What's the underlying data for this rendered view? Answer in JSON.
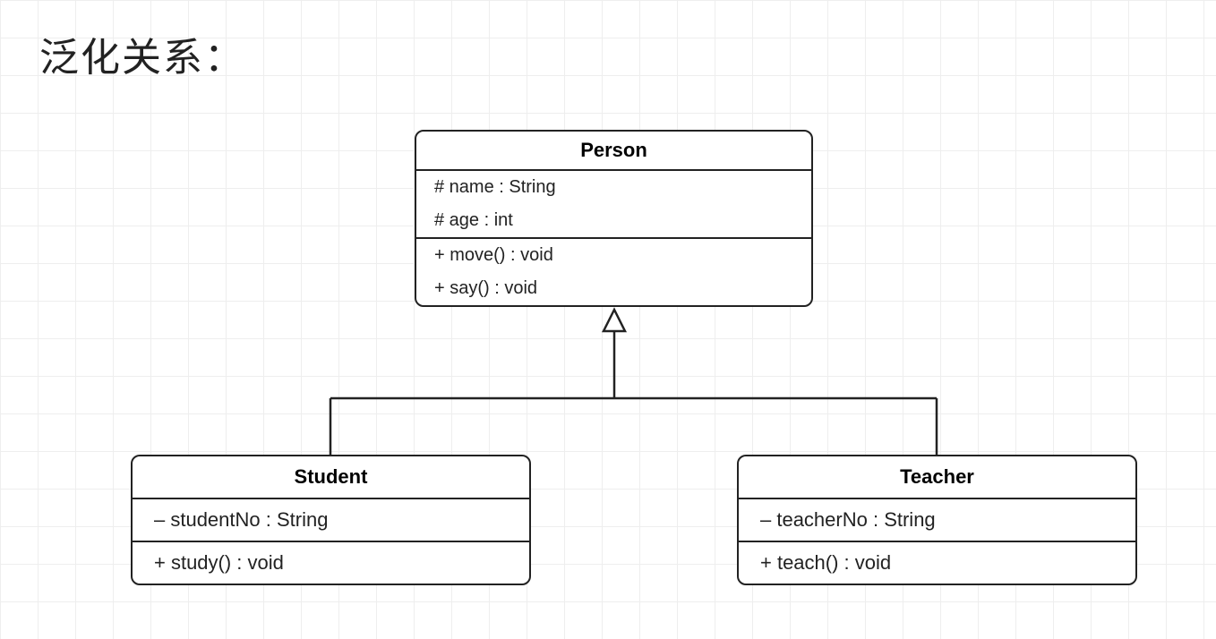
{
  "title": "泛化关系：",
  "classes": {
    "person": {
      "name": "Person",
      "attrs": [
        "# name : String",
        "# age : int"
      ],
      "ops": [
        "+ move() : void",
        "+ say() : void"
      ]
    },
    "student": {
      "name": "Student",
      "attrs": [
        "– studentNo : String"
      ],
      "ops": [
        "+ study() : void"
      ]
    },
    "teacher": {
      "name": "Teacher",
      "attrs": [
        "– teacherNo : String"
      ],
      "ops": [
        "+ teach() : void"
      ]
    }
  },
  "relationship": "generalization",
  "children_of_person": [
    "student",
    "teacher"
  ]
}
